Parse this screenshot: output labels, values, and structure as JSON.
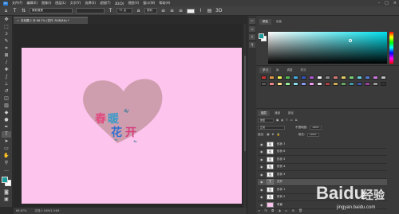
{
  "menubar": {
    "items": [
      "文件(F)",
      "编辑(E)",
      "图像(I)",
      "图层(L)",
      "文字(Y)",
      "选择(S)",
      "滤镜(T)",
      "3D(D)",
      "视图(V)",
      "窗口(W)",
      "帮助(H)"
    ],
    "logo": "Ps"
  },
  "options": {
    "font_family": "微软雅黑",
    "font_style": "",
    "font_size": "72 点",
    "antialias": "锐利",
    "text_color": "#eeeeee"
  },
  "document": {
    "tab_title": "未标题-1 @ 66.7% (花开, RGB/8#) *",
    "close": "×",
    "canvas_color": "#fdc4ee",
    "canvas_text": {
      "word1": "春",
      "word2": "暖",
      "word3": "花",
      "word4": "开"
    }
  },
  "status": {
    "zoom": "66.67%",
    "doc_info": "文档:1.54M/1.54M"
  },
  "colors": {
    "foreground": "#1d9a9a",
    "background": "#ffffff",
    "heart": "#c99aa6"
  },
  "color_panel": {
    "tabs": [
      "颜色",
      "色板"
    ]
  },
  "swatch_panel": {
    "tabs": [
      "学习",
      "库",
      "调整",
      "样式"
    ]
  },
  "layers_panel": {
    "tabs": [
      "图层",
      "通道",
      "路径"
    ],
    "filter_label": "类型",
    "blend_mode": "正常",
    "opacity_label": "不透明度:",
    "opacity_value": "100%",
    "fill_label": "填充:",
    "fill_value": "100%",
    "lock_label": "锁定:",
    "layers": [
      {
        "name": "形状 7",
        "thumb": "形",
        "type": "shape",
        "selected": false
      },
      {
        "name": "形状 6",
        "thumb": "形",
        "type": "shape",
        "selected": false
      },
      {
        "name": "形状 5",
        "thumb": "形",
        "type": "shape",
        "selected": false
      },
      {
        "name": "形状 4",
        "thumb": "形",
        "type": "shape",
        "selected": false
      },
      {
        "name": "形状 3",
        "thumb": "形",
        "type": "shape",
        "selected": false
      },
      {
        "name": "花开",
        "thumb": "T",
        "type": "text",
        "selected": true
      },
      {
        "name": "形状 1",
        "thumb": "形",
        "type": "shape",
        "selected": false
      },
      {
        "name": "形状 2",
        "thumb": "形",
        "type": "shape",
        "selected": false
      },
      {
        "name": "背景",
        "thumb": "",
        "type": "bg",
        "selected": false
      }
    ]
  },
  "watermark": {
    "brand": "Baidu",
    "suffix": "经验",
    "url": "jingyan.baidu.com"
  }
}
